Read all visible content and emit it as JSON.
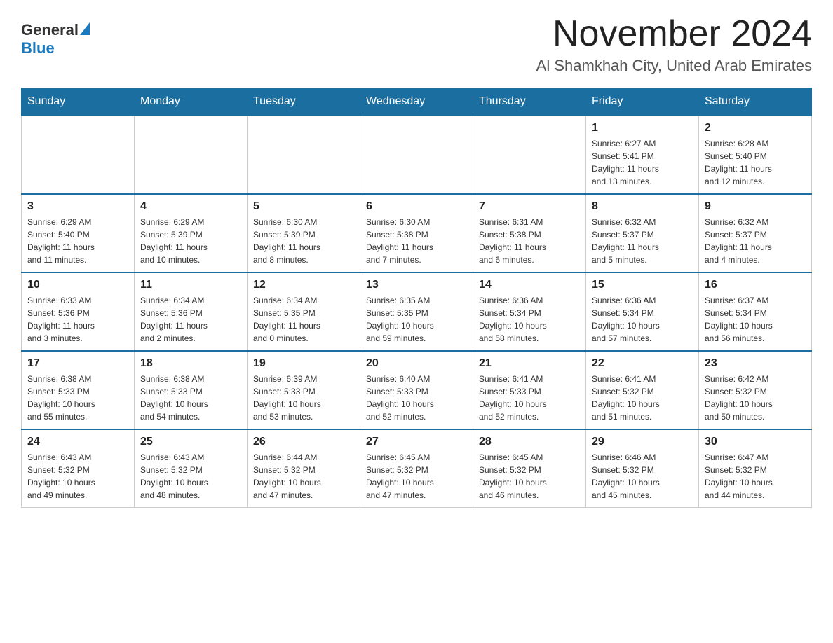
{
  "header": {
    "logo_general": "General",
    "logo_blue": "Blue",
    "month_title": "November 2024",
    "city_subtitle": "Al Shamkhah City, United Arab Emirates"
  },
  "days_of_week": [
    "Sunday",
    "Monday",
    "Tuesday",
    "Wednesday",
    "Thursday",
    "Friday",
    "Saturday"
  ],
  "weeks": [
    [
      {
        "day": "",
        "info": ""
      },
      {
        "day": "",
        "info": ""
      },
      {
        "day": "",
        "info": ""
      },
      {
        "day": "",
        "info": ""
      },
      {
        "day": "",
        "info": ""
      },
      {
        "day": "1",
        "info": "Sunrise: 6:27 AM\nSunset: 5:41 PM\nDaylight: 11 hours\nand 13 minutes."
      },
      {
        "day": "2",
        "info": "Sunrise: 6:28 AM\nSunset: 5:40 PM\nDaylight: 11 hours\nand 12 minutes."
      }
    ],
    [
      {
        "day": "3",
        "info": "Sunrise: 6:29 AM\nSunset: 5:40 PM\nDaylight: 11 hours\nand 11 minutes."
      },
      {
        "day": "4",
        "info": "Sunrise: 6:29 AM\nSunset: 5:39 PM\nDaylight: 11 hours\nand 10 minutes."
      },
      {
        "day": "5",
        "info": "Sunrise: 6:30 AM\nSunset: 5:39 PM\nDaylight: 11 hours\nand 8 minutes."
      },
      {
        "day": "6",
        "info": "Sunrise: 6:30 AM\nSunset: 5:38 PM\nDaylight: 11 hours\nand 7 minutes."
      },
      {
        "day": "7",
        "info": "Sunrise: 6:31 AM\nSunset: 5:38 PM\nDaylight: 11 hours\nand 6 minutes."
      },
      {
        "day": "8",
        "info": "Sunrise: 6:32 AM\nSunset: 5:37 PM\nDaylight: 11 hours\nand 5 minutes."
      },
      {
        "day": "9",
        "info": "Sunrise: 6:32 AM\nSunset: 5:37 PM\nDaylight: 11 hours\nand 4 minutes."
      }
    ],
    [
      {
        "day": "10",
        "info": "Sunrise: 6:33 AM\nSunset: 5:36 PM\nDaylight: 11 hours\nand 3 minutes."
      },
      {
        "day": "11",
        "info": "Sunrise: 6:34 AM\nSunset: 5:36 PM\nDaylight: 11 hours\nand 2 minutes."
      },
      {
        "day": "12",
        "info": "Sunrise: 6:34 AM\nSunset: 5:35 PM\nDaylight: 11 hours\nand 0 minutes."
      },
      {
        "day": "13",
        "info": "Sunrise: 6:35 AM\nSunset: 5:35 PM\nDaylight: 10 hours\nand 59 minutes."
      },
      {
        "day": "14",
        "info": "Sunrise: 6:36 AM\nSunset: 5:34 PM\nDaylight: 10 hours\nand 58 minutes."
      },
      {
        "day": "15",
        "info": "Sunrise: 6:36 AM\nSunset: 5:34 PM\nDaylight: 10 hours\nand 57 minutes."
      },
      {
        "day": "16",
        "info": "Sunrise: 6:37 AM\nSunset: 5:34 PM\nDaylight: 10 hours\nand 56 minutes."
      }
    ],
    [
      {
        "day": "17",
        "info": "Sunrise: 6:38 AM\nSunset: 5:33 PM\nDaylight: 10 hours\nand 55 minutes."
      },
      {
        "day": "18",
        "info": "Sunrise: 6:38 AM\nSunset: 5:33 PM\nDaylight: 10 hours\nand 54 minutes."
      },
      {
        "day": "19",
        "info": "Sunrise: 6:39 AM\nSunset: 5:33 PM\nDaylight: 10 hours\nand 53 minutes."
      },
      {
        "day": "20",
        "info": "Sunrise: 6:40 AM\nSunset: 5:33 PM\nDaylight: 10 hours\nand 52 minutes."
      },
      {
        "day": "21",
        "info": "Sunrise: 6:41 AM\nSunset: 5:33 PM\nDaylight: 10 hours\nand 52 minutes."
      },
      {
        "day": "22",
        "info": "Sunrise: 6:41 AM\nSunset: 5:32 PM\nDaylight: 10 hours\nand 51 minutes."
      },
      {
        "day": "23",
        "info": "Sunrise: 6:42 AM\nSunset: 5:32 PM\nDaylight: 10 hours\nand 50 minutes."
      }
    ],
    [
      {
        "day": "24",
        "info": "Sunrise: 6:43 AM\nSunset: 5:32 PM\nDaylight: 10 hours\nand 49 minutes."
      },
      {
        "day": "25",
        "info": "Sunrise: 6:43 AM\nSunset: 5:32 PM\nDaylight: 10 hours\nand 48 minutes."
      },
      {
        "day": "26",
        "info": "Sunrise: 6:44 AM\nSunset: 5:32 PM\nDaylight: 10 hours\nand 47 minutes."
      },
      {
        "day": "27",
        "info": "Sunrise: 6:45 AM\nSunset: 5:32 PM\nDaylight: 10 hours\nand 47 minutes."
      },
      {
        "day": "28",
        "info": "Sunrise: 6:45 AM\nSunset: 5:32 PM\nDaylight: 10 hours\nand 46 minutes."
      },
      {
        "day": "29",
        "info": "Sunrise: 6:46 AM\nSunset: 5:32 PM\nDaylight: 10 hours\nand 45 minutes."
      },
      {
        "day": "30",
        "info": "Sunrise: 6:47 AM\nSunset: 5:32 PM\nDaylight: 10 hours\nand 44 minutes."
      }
    ]
  ]
}
